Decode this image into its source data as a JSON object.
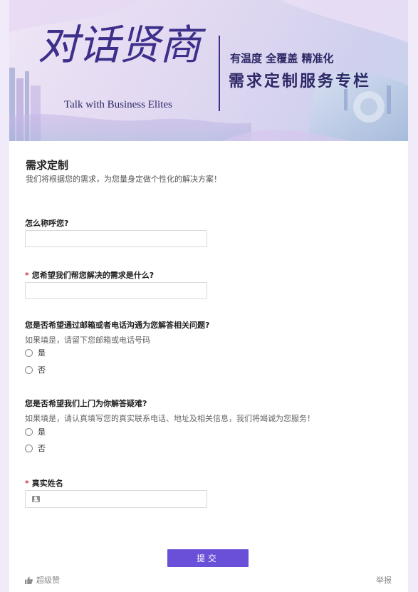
{
  "banner": {
    "title": "对话贤商",
    "subtitle": "Talk with Business Elites",
    "tagline": "有温度 全覆盖 精准化",
    "column": "需求定制服务专栏"
  },
  "form": {
    "title": "需求定制",
    "description": "我们将根据您的需求，为您量身定做个性化的解决方案！"
  },
  "questions": {
    "q1": {
      "label": "怎么称呼您?",
      "required": false,
      "value": ""
    },
    "q2": {
      "label": "您希望我们帮您解决的需求是什么?",
      "required": true,
      "required_mark": "*",
      "value": ""
    },
    "q3": {
      "label": "您是否希望通过邮箱或者电话沟通为您解答相关问题?",
      "hint": "如果填是，请留下您邮箱或电话号码",
      "options": [
        "是",
        "否"
      ]
    },
    "q4": {
      "label": "您是否希望我们上门为你解答疑难?",
      "hint": "如果填是，请认真填写您的真实联系电话、地址及相关信息，我们将竭诚为您服务！",
      "options": [
        "是",
        "否"
      ]
    },
    "q5": {
      "label": "真实姓名",
      "required": true,
      "required_mark": "*",
      "value": ""
    }
  },
  "actions": {
    "submit_label": "提交",
    "like_label": "超级赞",
    "report_label": "举报"
  },
  "colors": {
    "accent": "#6a4fd8",
    "required": "#e0334a",
    "page_bg": "#f1eaf8",
    "banner_text": "#3d2f8a"
  },
  "icons": {
    "like": "thumbs-up-icon",
    "name_field": "contact-card-icon"
  }
}
